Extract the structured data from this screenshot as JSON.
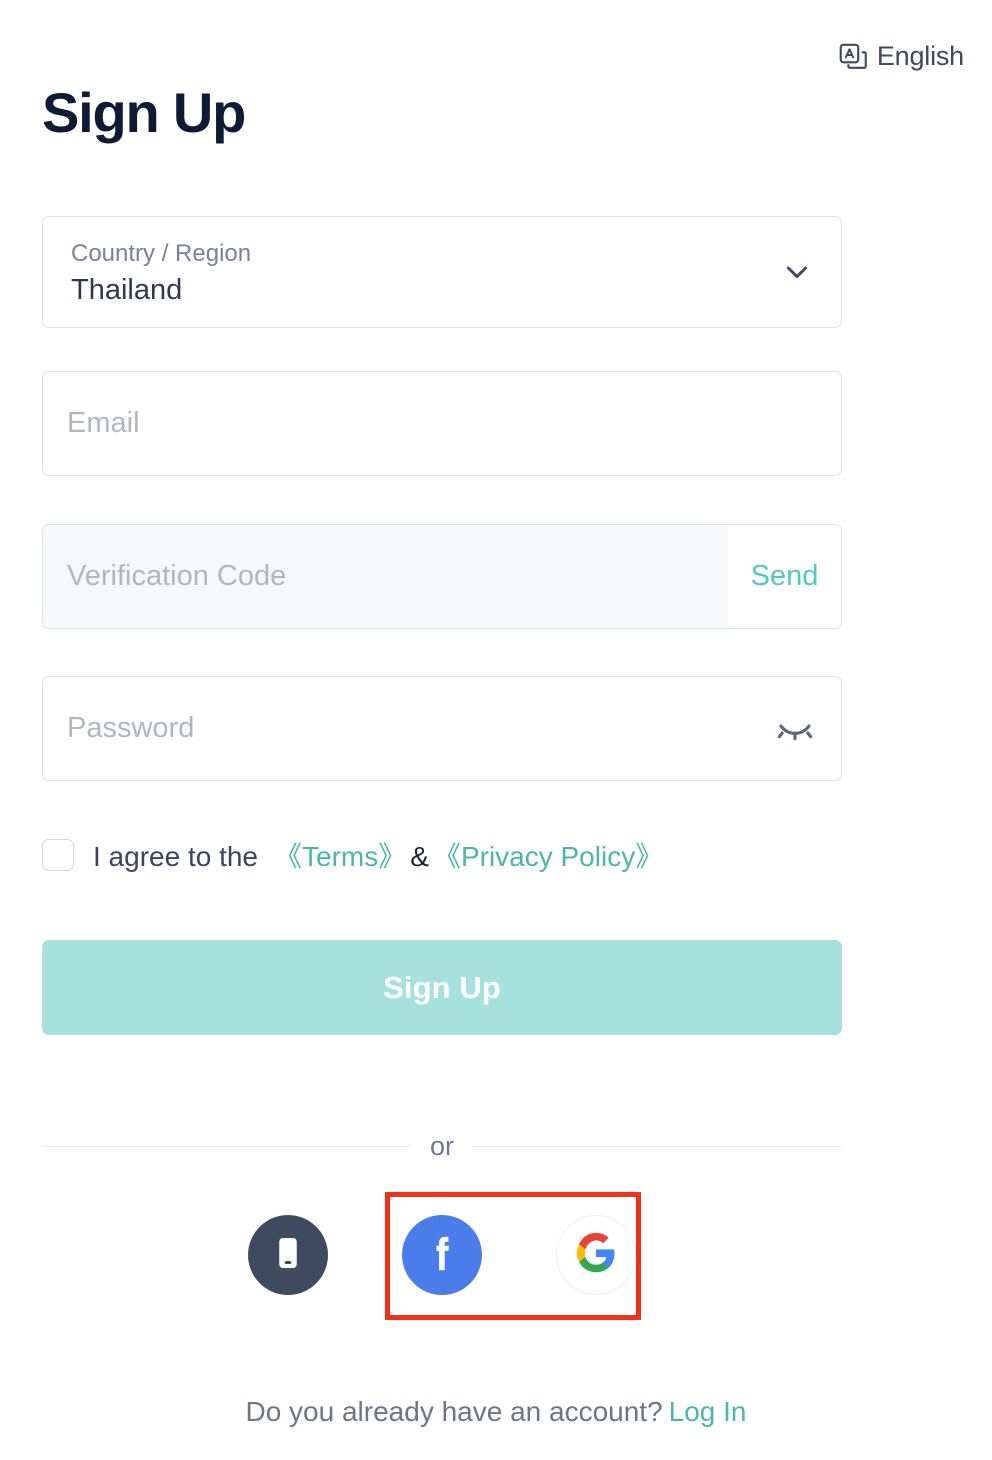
{
  "language_selector": {
    "label": "English",
    "icon": "translate-icon"
  },
  "page_title": "Sign Up",
  "form": {
    "country": {
      "label": "Country / Region",
      "value": "Thailand",
      "icon": "chevron-down-icon"
    },
    "email": {
      "placeholder": "Email",
      "value": ""
    },
    "verification_code": {
      "placeholder": "Verification Code",
      "value": "",
      "send_label": "Send"
    },
    "password": {
      "placeholder": "Password",
      "value": "",
      "icon": "eye-off-icon"
    }
  },
  "agreement": {
    "checked": false,
    "text": "I agree to the",
    "terms_label": "《Terms》",
    "separator": "&",
    "privacy_label": "《Privacy Policy》"
  },
  "submit_button": {
    "label": "Sign Up"
  },
  "divider": {
    "text": "or"
  },
  "social_logins": [
    {
      "name": "phone",
      "icon": "mobile-phone-icon",
      "label": "Phone"
    },
    {
      "name": "facebook",
      "icon": "facebook-icon",
      "label": "Facebook"
    },
    {
      "name": "google",
      "icon": "google-icon",
      "label": "Google"
    }
  ],
  "footer": {
    "question": "Do you already have an account?",
    "login_label": "Log In"
  },
  "colors": {
    "accent_teal": "#4db6ac",
    "send_teal": "#52c9c0",
    "button_teal": "#a7e1dd",
    "title_navy": "#0d1b34",
    "border": "#dbe3ec",
    "facebook_blue": "#4a7cea",
    "phone_slate": "#3e4a5e",
    "highlight_red": "#f03017"
  }
}
